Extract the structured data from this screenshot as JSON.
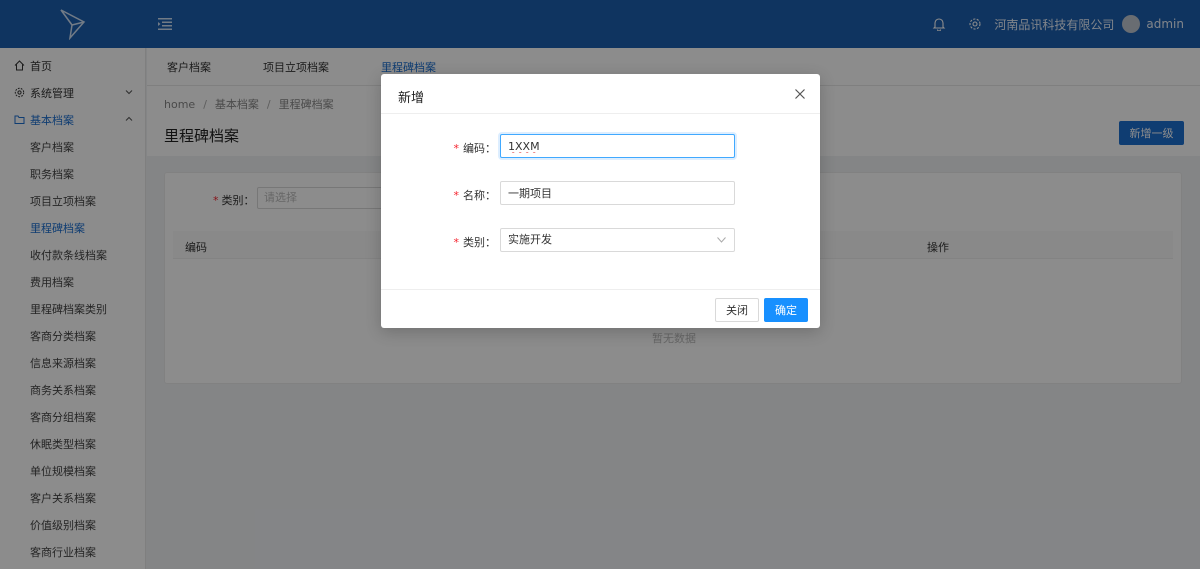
{
  "header": {
    "company": "河南品讯科技有限公司",
    "user": "admin"
  },
  "sidebar": {
    "items": [
      {
        "label": "首页",
        "icon": "home-icon"
      },
      {
        "label": "系统管理",
        "icon": "gear-icon"
      },
      {
        "label": "基本档案",
        "icon": "folder-icon"
      }
    ],
    "sub_items": [
      "客户档案",
      "职务档案",
      "项目立项档案",
      "里程碑档案",
      "收付款条线档案",
      "费用档案",
      "里程碑档案类别",
      "客商分类档案",
      "信息来源档案",
      "商务关系档案",
      "客商分组档案",
      "休眠类型档案",
      "单位规模档案",
      "客户关系档案",
      "价值级别档案",
      "客商行业档案"
    ],
    "active_sub": "里程碑档案"
  },
  "tabs": [
    "客户档案",
    "项目立项档案",
    "里程碑档案"
  ],
  "breadcrumb": [
    "home",
    "基本档案",
    "里程碑档案"
  ],
  "page": {
    "title": "里程碑档案",
    "add_button": "新增一级"
  },
  "filter": {
    "label": "类别",
    "placeholder": "请选择"
  },
  "table": {
    "columns": [
      "编码",
      "操作"
    ],
    "empty_text": "暂无数据"
  },
  "modal": {
    "title": "新增",
    "fields": {
      "code_label": "编码",
      "code_value": "1XXM",
      "name_label": "名称",
      "name_value": "一期项目",
      "category_label": "类别",
      "category_value": "实施开发"
    },
    "close_button": "关闭",
    "ok_button": "确定"
  },
  "colors": {
    "header_bg": "#1c5fb0",
    "accent": "#1c6fd0",
    "primary_button": "#1890ff",
    "required": "#f5222d"
  }
}
